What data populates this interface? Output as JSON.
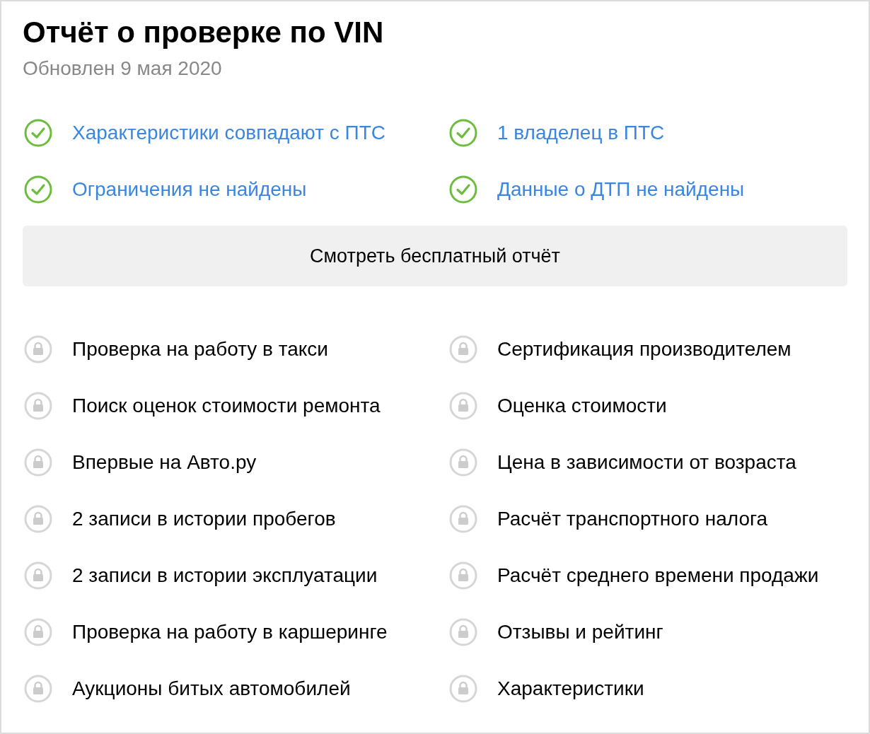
{
  "title": "Отчёт о проверке по VIN",
  "updated": "Обновлен 9 мая 2020",
  "checks": [
    {
      "label": "Характеристики совпадают с ПТС"
    },
    {
      "label": "1 владелец в ПТС"
    },
    {
      "label": "Ограничения не найдены"
    },
    {
      "label": "Данные о ДТП не найдены"
    }
  ],
  "button": "Смотреть бесплатный отчёт",
  "locked_features": [
    {
      "label": "Проверка на работу в такси"
    },
    {
      "label": "Сертификация производителем"
    },
    {
      "label": "Поиск оценок стоимости ремонта"
    },
    {
      "label": "Оценка стоимости"
    },
    {
      "label": "Впервые на Авто.ру"
    },
    {
      "label": "Цена в зависимости от возраста"
    },
    {
      "label": "2 записи в истории пробегов"
    },
    {
      "label": "Расчёт транспортного налога"
    },
    {
      "label": "2 записи в истории эксплуатации"
    },
    {
      "label": "Расчёт среднего времени продажи"
    },
    {
      "label": "Проверка на работу в каршеринге"
    },
    {
      "label": "Отзывы и рейтинг"
    },
    {
      "label": "Аукционы битых автомобилей"
    },
    {
      "label": "Характеристики"
    }
  ]
}
